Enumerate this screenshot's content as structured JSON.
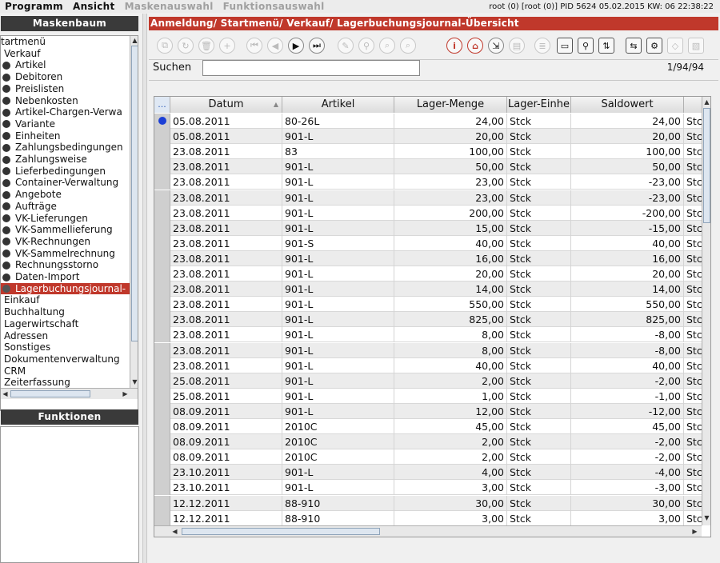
{
  "menubar": {
    "items": [
      "Programm",
      "Ansicht",
      "Maskenauswahl",
      "Funktionsauswahl"
    ],
    "status": "root (0) [root (0)] PID 5624  05.02.2015 KW: 06  22:38:22"
  },
  "left": {
    "mask_title": "Maskenbaum",
    "func_title": "Funktionen",
    "tree": [
      {
        "label": "tartmenü",
        "level": 0,
        "dot": false
      },
      {
        "label": "Verkauf",
        "level": 0,
        "dot": false
      },
      {
        "label": "Artikel",
        "level": 1,
        "dot": true
      },
      {
        "label": "Debitoren",
        "level": 1,
        "dot": true
      },
      {
        "label": "Preislisten",
        "level": 1,
        "dot": true
      },
      {
        "label": "Nebenkosten",
        "level": 1,
        "dot": true
      },
      {
        "label": "Artikel-Chargen-Verwa",
        "level": 1,
        "dot": true
      },
      {
        "label": "Variante",
        "level": 1,
        "dot": true
      },
      {
        "label": "Einheiten",
        "level": 1,
        "dot": true
      },
      {
        "label": "Zahlungsbedingungen",
        "level": 1,
        "dot": true
      },
      {
        "label": "Zahlungsweise",
        "level": 1,
        "dot": true
      },
      {
        "label": "Lieferbedingungen",
        "level": 1,
        "dot": true
      },
      {
        "label": "Container-Verwaltung",
        "level": 1,
        "dot": true
      },
      {
        "label": "Angebote",
        "level": 1,
        "dot": true
      },
      {
        "label": "Aufträge",
        "level": 1,
        "dot": true
      },
      {
        "label": "VK-Lieferungen",
        "level": 1,
        "dot": true
      },
      {
        "label": "VK-Sammellieferung",
        "level": 1,
        "dot": true
      },
      {
        "label": "VK-Rechnungen",
        "level": 1,
        "dot": true
      },
      {
        "label": "VK-Sammelrechnung",
        "level": 1,
        "dot": true
      },
      {
        "label": "Rechnungsstorno",
        "level": 1,
        "dot": true
      },
      {
        "label": "Daten-Import",
        "level": 1,
        "dot": true
      },
      {
        "label": "Lagerbuchungsjournal-",
        "level": 1,
        "dot": true,
        "selected": true
      },
      {
        "label": "Einkauf",
        "level": 0,
        "dot": false
      },
      {
        "label": "Buchhaltung",
        "level": 0,
        "dot": false
      },
      {
        "label": "Lagerwirtschaft",
        "level": 0,
        "dot": false
      },
      {
        "label": "Adressen",
        "level": 0,
        "dot": false
      },
      {
        "label": "Sonstiges",
        "level": 0,
        "dot": false
      },
      {
        "label": "Dokumentenverwaltung",
        "level": 0,
        "dot": false
      },
      {
        "label": "CRM",
        "level": 0,
        "dot": false
      },
      {
        "label": "Zeiterfassung",
        "level": 0,
        "dot": false
      }
    ]
  },
  "breadcrumb": "Anmeldung/ Startmenü/ Verkauf/ Lagerbuchungsjournal-Übersicht",
  "toolbar": [
    {
      "name": "copy-icon",
      "glyph": "⧉",
      "style": "round",
      "active": false
    },
    {
      "name": "refresh-icon",
      "glyph": "↻",
      "style": "round",
      "active": false
    },
    {
      "name": "delete-icon",
      "glyph": "🗑",
      "style": "round",
      "active": false
    },
    {
      "name": "add-icon",
      "glyph": "+",
      "style": "round",
      "active": false
    },
    {
      "name": "first-record-icon",
      "glyph": "⏮",
      "style": "round",
      "active": false
    },
    {
      "name": "previous-record-icon",
      "glyph": "◀",
      "style": "round",
      "active": false
    },
    {
      "name": "next-record-icon",
      "glyph": "▶",
      "style": "round",
      "active": true
    },
    {
      "name": "last-record-icon",
      "glyph": "⏭",
      "style": "round",
      "active": true
    },
    {
      "name": "edit-icon",
      "glyph": "✎",
      "style": "round",
      "active": false
    },
    {
      "name": "tool-icon",
      "glyph": "⚲",
      "style": "round",
      "active": false
    },
    {
      "name": "find-icon",
      "glyph": "⌕",
      "style": "round",
      "active": false
    },
    {
      "name": "find-next-icon",
      "glyph": "⌕",
      "style": "round",
      "active": false
    },
    {
      "name": "info-icon",
      "glyph": "i",
      "style": "red",
      "active": true
    },
    {
      "name": "home-icon",
      "glyph": "⌂",
      "style": "red",
      "active": true
    },
    {
      "name": "exit-icon",
      "glyph": "⇲",
      "style": "round",
      "active": true
    },
    {
      "name": "print-icon",
      "glyph": "▤",
      "style": "round",
      "active": false
    },
    {
      "name": "list-icon",
      "glyph": "≣",
      "style": "round",
      "active": false
    },
    {
      "name": "window-icon",
      "glyph": "▭",
      "style": "sq",
      "active": true
    },
    {
      "name": "search-icon",
      "glyph": "⚲",
      "style": "sq",
      "active": true
    },
    {
      "name": "sort-icon",
      "glyph": "⇅",
      "style": "sq",
      "active": true
    },
    {
      "name": "transfer-icon",
      "glyph": "⇆",
      "style": "sq",
      "active": true
    },
    {
      "name": "settings-icon",
      "glyph": "⚙",
      "style": "sq",
      "active": true
    },
    {
      "name": "tag-icon",
      "glyph": "◇",
      "style": "sq",
      "active": false
    },
    {
      "name": "note-icon",
      "glyph": "▧",
      "style": "sq",
      "active": false
    }
  ],
  "search": {
    "label": "Suchen",
    "value": "",
    "placeholder": ""
  },
  "record_counter": "1/94/94",
  "table": {
    "corner": "...",
    "columns": [
      "Datum",
      "Artikel",
      "Lager-Menge",
      "Lager-Einhe",
      "Saldowert",
      ""
    ],
    "rows": [
      [
        "05.08.2011",
        "80-26L",
        "24,00",
        "Stck",
        "24,00",
        "Stc"
      ],
      [
        "05.08.2011",
        "901-L",
        "20,00",
        "Stck",
        "20,00",
        "Stc"
      ],
      [
        "23.08.2011",
        "83",
        "100,00",
        "Stck",
        "100,00",
        "Stc"
      ],
      [
        "23.08.2011",
        "901-L",
        "50,00",
        "Stck",
        "50,00",
        "Stc"
      ],
      [
        "23.08.2011",
        "901-L",
        "23,00",
        "Stck",
        "-23,00",
        "Stc"
      ],
      [
        "23.08.2011",
        "901-L",
        "23,00",
        "Stck",
        "-23,00",
        "Stc"
      ],
      [
        "23.08.2011",
        "901-L",
        "200,00",
        "Stck",
        "-200,00",
        "Stc"
      ],
      [
        "23.08.2011",
        "901-L",
        "15,00",
        "Stck",
        "-15,00",
        "Stc"
      ],
      [
        "23.08.2011",
        "901-S",
        "40,00",
        "Stck",
        "40,00",
        "Stc"
      ],
      [
        "23.08.2011",
        "901-L",
        "16,00",
        "Stck",
        "16,00",
        "Stc"
      ],
      [
        "23.08.2011",
        "901-L",
        "20,00",
        "Stck",
        "20,00",
        "Stc"
      ],
      [
        "23.08.2011",
        "901-L",
        "14,00",
        "Stck",
        "14,00",
        "Stc"
      ],
      [
        "23.08.2011",
        "901-L",
        "550,00",
        "Stck",
        "550,00",
        "Stc"
      ],
      [
        "23.08.2011",
        "901-L",
        "825,00",
        "Stck",
        "825,00",
        "Stc"
      ],
      [
        "23.08.2011",
        "901-L",
        "8,00",
        "Stck",
        "-8,00",
        "Stc"
      ],
      [
        "23.08.2011",
        "901-L",
        "8,00",
        "Stck",
        "-8,00",
        "Stc"
      ],
      [
        "23.08.2011",
        "901-L",
        "40,00",
        "Stck",
        "40,00",
        "Stc"
      ],
      [
        "25.08.2011",
        "901-L",
        "2,00",
        "Stck",
        "-2,00",
        "Stc"
      ],
      [
        "25.08.2011",
        "901-L",
        "1,00",
        "Stck",
        "-1,00",
        "Stc"
      ],
      [
        "08.09.2011",
        "901-L",
        "12,00",
        "Stck",
        "-12,00",
        "Stc"
      ],
      [
        "08.09.2011",
        "2010C",
        "45,00",
        "Stck",
        "45,00",
        "Stc"
      ],
      [
        "08.09.2011",
        "2010C",
        "2,00",
        "Stck",
        "-2,00",
        "Stc"
      ],
      [
        "08.09.2011",
        "2010C",
        "2,00",
        "Stck",
        "-2,00",
        "Stc"
      ],
      [
        "23.10.2011",
        "901-L",
        "4,00",
        "Stck",
        "-4,00",
        "Stc"
      ],
      [
        "23.10.2011",
        "901-L",
        "3,00",
        "Stck",
        "-3,00",
        "Stc"
      ],
      [
        "12.12.2011",
        "88-910",
        "30,00",
        "Stck",
        "30,00",
        "Stc"
      ],
      [
        "12.12.2011",
        "88-910",
        "3,00",
        "Stck",
        "3,00",
        "Stc"
      ]
    ]
  },
  "colors": {
    "accent": "#c0382b",
    "header_dark": "#3a3a3a",
    "marker_dot": "#1b3fd6"
  }
}
